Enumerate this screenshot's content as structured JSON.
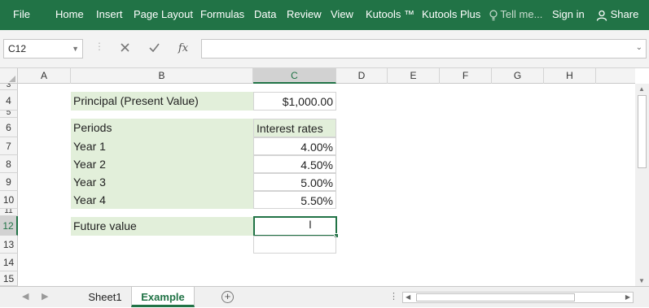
{
  "ribbon": {
    "tabs": [
      "File",
      "Home",
      "Insert",
      "Page Layout",
      "Formulas",
      "Data",
      "Review",
      "View",
      "Kutools ™",
      "Kutools Plus"
    ],
    "tell_me": "Tell me...",
    "sign_in": "Sign in",
    "share": "Share"
  },
  "formula_bar": {
    "name_box": "C12",
    "cancel_icon": "close-icon",
    "enter_icon": "check-icon",
    "fx_label": "fx",
    "formula": ""
  },
  "grid": {
    "columns": [
      "A",
      "B",
      "C",
      "D",
      "E",
      "F",
      "G",
      "H"
    ],
    "selected_column": "C",
    "rows": [
      "3",
      "4",
      "5",
      "6",
      "7",
      "8",
      "9",
      "10",
      "11",
      "12",
      "13",
      "14",
      "15"
    ],
    "selected_row": "12",
    "cells": {
      "b4": "Principal (Present Value)",
      "c4": "$1,000.00",
      "b6": "Periods",
      "c6": "Interest rates",
      "b7": "Year 1",
      "c7": "4.00%",
      "b8": "Year 2",
      "c8": "4.50%",
      "b9": "Year 3",
      "c9": "5.00%",
      "b10": "Year 4",
      "c10": "5.50%",
      "b12": "Future value",
      "c12": ""
    }
  },
  "sheets": {
    "tabs": [
      "Sheet1",
      "Example"
    ],
    "active": "Example"
  },
  "colors": {
    "brand_green": "#217346",
    "label_fill": "#e2efda"
  }
}
